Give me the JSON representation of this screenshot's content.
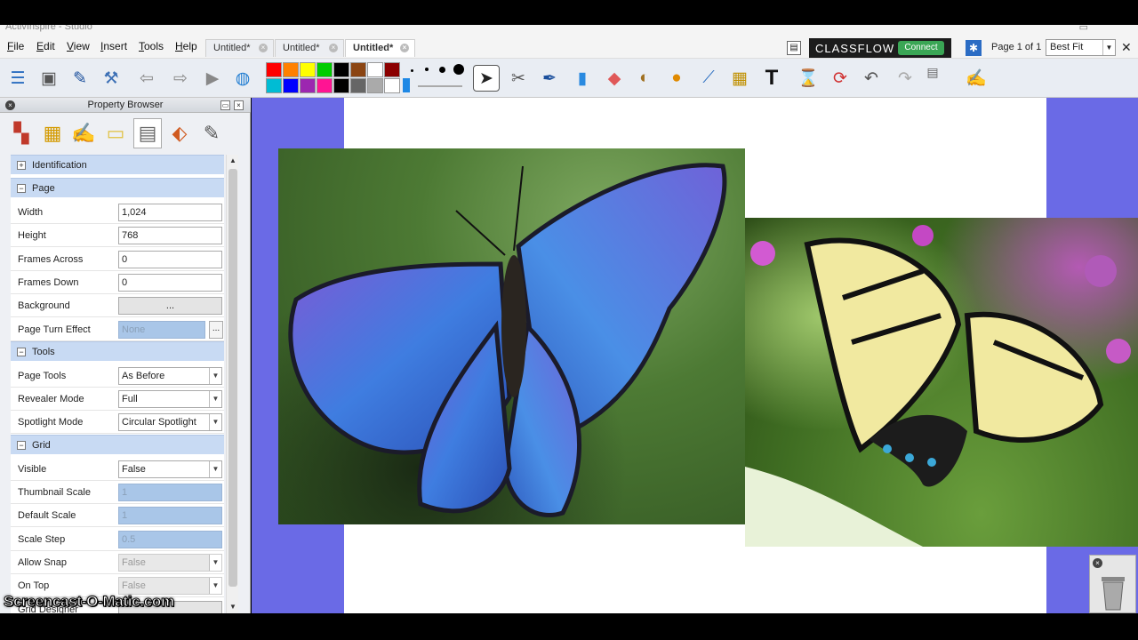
{
  "window": {
    "title": "ActivInspire - Studio"
  },
  "menu": {
    "items": [
      "File",
      "Edit",
      "View",
      "Insert",
      "Tools",
      "Help"
    ],
    "underline": [
      "F",
      "E",
      "V",
      "I",
      "T",
      "H"
    ]
  },
  "tabs": [
    {
      "label": "Untitled*",
      "active": false
    },
    {
      "label": "Untitled*",
      "active": false
    },
    {
      "label": "Untitled*",
      "active": true
    }
  ],
  "classflow": {
    "label": "CLASSFLOW",
    "connect": "Connect"
  },
  "page_indicator": "Page 1 of 1",
  "zoom": {
    "value": "Best Fit"
  },
  "toolbar": {
    "colors_top": [
      "#ff0000",
      "#ff8000",
      "#ffff00",
      "#00cc00",
      "#000000",
      "#8b4513",
      "#ffffff",
      "#8b0000"
    ],
    "colors_bottom": [
      "#00bcd4",
      "#0000ff",
      "#9c27b0",
      "#ff1493",
      "#000000",
      "#666666",
      "#aaaaaa",
      "#ffffff"
    ]
  },
  "property_browser": {
    "title": "Property Browser",
    "sections": [
      {
        "label": "Identification",
        "expanded": false,
        "rows": []
      },
      {
        "label": "Page",
        "expanded": true,
        "rows": [
          {
            "label": "Width",
            "value": "1,024",
            "kind": "text"
          },
          {
            "label": "Height",
            "value": "768",
            "kind": "text"
          },
          {
            "label": "Frames Across",
            "value": "0",
            "kind": "text"
          },
          {
            "label": "Frames Down",
            "value": "0",
            "kind": "text"
          },
          {
            "label": "Background",
            "value": "...",
            "kind": "button"
          },
          {
            "label": "Page Turn Effect",
            "value": "None",
            "kind": "disabled-ellipsis"
          }
        ]
      },
      {
        "label": "Tools",
        "expanded": true,
        "rows": [
          {
            "label": "Page Tools",
            "value": "As Before",
            "kind": "select"
          },
          {
            "label": "Revealer Mode",
            "value": "Full",
            "kind": "select"
          },
          {
            "label": "Spotlight Mode",
            "value": "Circular Spotlight",
            "kind": "select"
          }
        ]
      },
      {
        "label": "Grid",
        "expanded": true,
        "rows": [
          {
            "label": "Visible",
            "value": "False",
            "kind": "select"
          },
          {
            "label": "Thumbnail Scale",
            "value": "1",
            "kind": "disabled"
          },
          {
            "label": "Default Scale",
            "value": "1",
            "kind": "disabled"
          },
          {
            "label": "Scale Step",
            "value": "0.5",
            "kind": "disabled"
          },
          {
            "label": "Allow Snap",
            "value": "False",
            "kind": "gray-select"
          },
          {
            "label": "On Top",
            "value": "False",
            "kind": "gray-select"
          },
          {
            "label": "Grid Designer",
            "value": "",
            "kind": "button"
          }
        ]
      }
    ]
  },
  "watermark": "Screencast-O-Matic.com"
}
